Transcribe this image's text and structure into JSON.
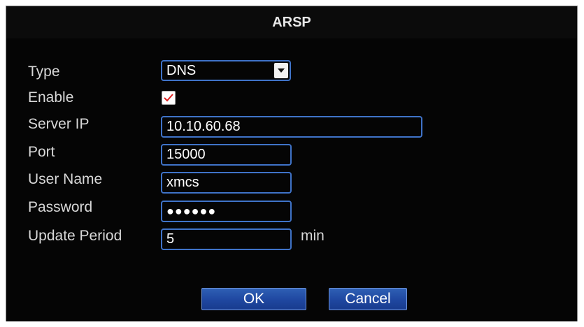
{
  "window": {
    "title": "ARSP"
  },
  "form": {
    "type": {
      "label": "Type",
      "value": "DNS"
    },
    "enable": {
      "label": "Enable",
      "checked": true
    },
    "server_ip": {
      "label": "Server IP",
      "value": "10.10.60.68"
    },
    "port": {
      "label": "Port",
      "value": "15000"
    },
    "user_name": {
      "label": "User Name",
      "value": "xmcs"
    },
    "password": {
      "label": "Password",
      "masked_value": "●●●●●●"
    },
    "update_period": {
      "label": "Update Period",
      "value": "5",
      "unit": "min"
    }
  },
  "buttons": {
    "ok": "OK",
    "cancel": "Cancel"
  },
  "colors": {
    "background": "#050505",
    "field_border": "#3f73c8",
    "button_fill": "#1f47a0",
    "check_mark": "#e02020",
    "text": "#d8d8d8"
  },
  "icons": {
    "dropdown": "chevron-down-icon",
    "check": "check-icon"
  }
}
